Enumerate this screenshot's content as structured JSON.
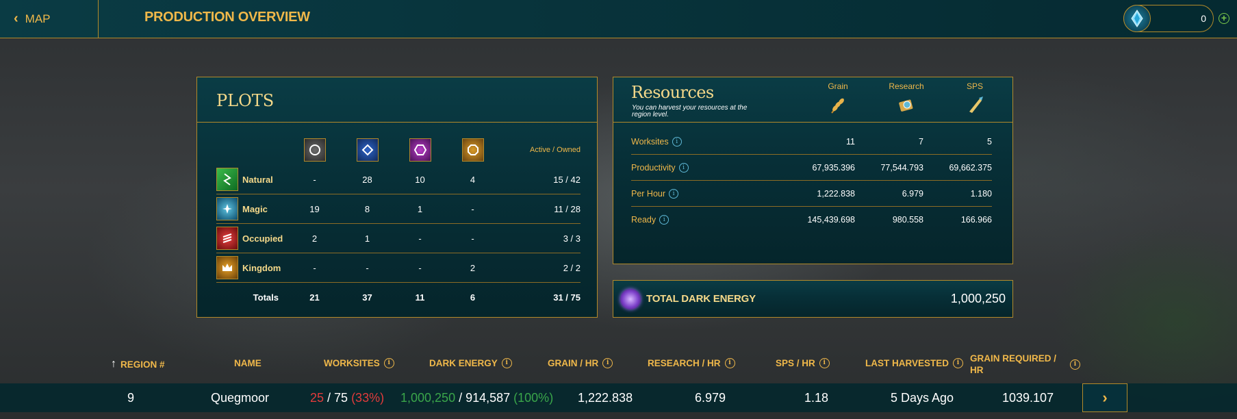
{
  "topbar": {
    "back_label": "MAP",
    "title": "PRODUCTION OVERVIEW",
    "currency_value": "0",
    "plus_icon": "plus-icon",
    "gem_icon": "gem-icon"
  },
  "plots": {
    "title": "PLOTS",
    "column_icons": [
      "circle-icon",
      "diamond-icon",
      "hexagon-icon",
      "octagon-icon"
    ],
    "active_owned_label": "Active / Owned",
    "rows": [
      {
        "name": "Natural",
        "icon": "natural-icon",
        "values": [
          "-",
          "28",
          "10",
          "4"
        ],
        "active_owned": "15 / 42"
      },
      {
        "name": "Magic",
        "icon": "magic-icon",
        "values": [
          "19",
          "8",
          "1",
          "-"
        ],
        "active_owned": "11 / 28"
      },
      {
        "name": "Occupied",
        "icon": "occupied-icon",
        "values": [
          "2",
          "1",
          "-",
          "-"
        ],
        "active_owned": "3 / 3"
      },
      {
        "name": "Kingdom",
        "icon": "kingdom-icon",
        "values": [
          "-",
          "-",
          "-",
          "2"
        ],
        "active_owned": "2 / 2"
      }
    ],
    "totals": {
      "label": "Totals",
      "values": [
        "21",
        "37",
        "11",
        "6"
      ],
      "active_owned": "31 / 75"
    }
  },
  "resources": {
    "title": "Resources",
    "subtitle": "You can harvest your resources at the region level.",
    "columns": [
      {
        "label": "Grain",
        "icon": "grain-icon"
      },
      {
        "label": "Research",
        "icon": "research-icon"
      },
      {
        "label": "SPS",
        "icon": "sps-icon"
      }
    ],
    "rows": [
      {
        "label": "Worksites",
        "values": [
          "11",
          "7",
          "5"
        ]
      },
      {
        "label": "Productivity",
        "values": [
          "67,935.396",
          "77,544.793",
          "69,662.375"
        ]
      },
      {
        "label": "Per Hour",
        "values": [
          "1,222.838",
          "6.979",
          "1.180"
        ]
      },
      {
        "label": "Ready",
        "values": [
          "145,439.698",
          "980.558",
          "166.966"
        ]
      }
    ]
  },
  "dark_energy": {
    "label": "TOTAL DARK ENERGY",
    "value": "1,000,250",
    "icon": "dark-energy-orb-icon"
  },
  "region_table": {
    "sort_icon": "sort-up-arrow-icon",
    "headers": {
      "region": "REGION #",
      "name": "NAME",
      "worksites": "WORKSITES",
      "dark_energy": "DARK ENERGY",
      "grain_hr": "GRAIN / HR",
      "research_hr": "RESEARCH / HR",
      "sps_hr": "SPS / HR",
      "last_harvested": "LAST HARVESTED",
      "grain_required": "GRAIN REQUIRED / HR"
    },
    "rows": [
      {
        "region": "9",
        "name": "Quegmoor",
        "worksites_active": "25",
        "worksites_sep": " / 75 ",
        "worksites_pct": "(33%)",
        "dark_energy_have": "1,000,250",
        "dark_energy_sep": " / 914,587 ",
        "dark_energy_pct": "(100%)",
        "grain_hr": "1,222.838",
        "research_hr": "6.979",
        "sps_hr": "1.18",
        "last_harvested": "5 Days Ago",
        "grain_required": "1039.107",
        "go_icon": "go-chevron-icon"
      }
    ]
  },
  "colors": {
    "accent_gold": "#f0b84a",
    "panel_teal": "#0a3c45",
    "warning_red": "#e23b3b",
    "ok_green": "#3aa64a"
  }
}
